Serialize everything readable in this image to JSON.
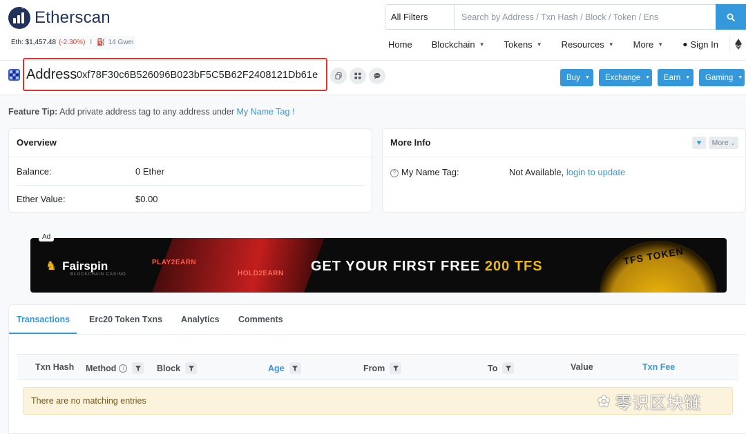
{
  "header": {
    "logo_text": "Etherscan",
    "price_prefix": "Eth: $1,457.48",
    "price_change": "(-2.30%)",
    "separator": "I",
    "gas": "14 Gwei",
    "filter_label": "All Filters",
    "search_placeholder": "Search by Address / Txn Hash / Block / Token / Ens"
  },
  "nav": {
    "home": "Home",
    "blockchain": "Blockchain",
    "tokens": "Tokens",
    "resources": "Resources",
    "more": "More",
    "sign_in": "Sign In"
  },
  "address": {
    "label": "Address",
    "hash": "0xf78F30c6B526096B023bF5C5B62F2408121Db61e",
    "buttons": {
      "buy": "Buy",
      "exchange": "Exchange",
      "earn": "Earn",
      "gaming": "Gaming"
    }
  },
  "tip": {
    "prefix": "Feature Tip:",
    "text": "Add private address tag to any address under",
    "link": "My Name Tag !"
  },
  "overview": {
    "title": "Overview",
    "balance_label": "Balance:",
    "balance_value": "0 Ether",
    "ether_value_label": "Ether Value:",
    "ether_value": "$0.00"
  },
  "more_info": {
    "title": "More Info",
    "more_button": "More",
    "name_tag_label": "My Name Tag:",
    "name_tag_value": "Not Available,",
    "name_tag_link": "login to update"
  },
  "ad": {
    "tag": "Ad",
    "brand": "Fairspin",
    "brand_sub": "BLOCKCHAIN CASINO",
    "play2earn": "PLAY2EARN",
    "hold2earn": "HOLD2EARN",
    "headline_main": "GET YOUR FIRST FREE",
    "headline_highlight": "200 TFS",
    "coin_text": "TFS TOKEN"
  },
  "tabs": [
    "Transactions",
    "Erc20 Token Txns",
    "Analytics",
    "Comments"
  ],
  "table": {
    "columns": [
      "Txn Hash",
      "Method",
      "Block",
      "Age",
      "From",
      "To",
      "Value",
      "Txn Fee"
    ],
    "empty_message": "There are no matching entries"
  },
  "watermark": "零识区块链",
  "colors": {
    "accent": "#3498db",
    "negative": "#de4437",
    "highlight_box": "#e0332b",
    "brand_dark": "#21325b"
  }
}
